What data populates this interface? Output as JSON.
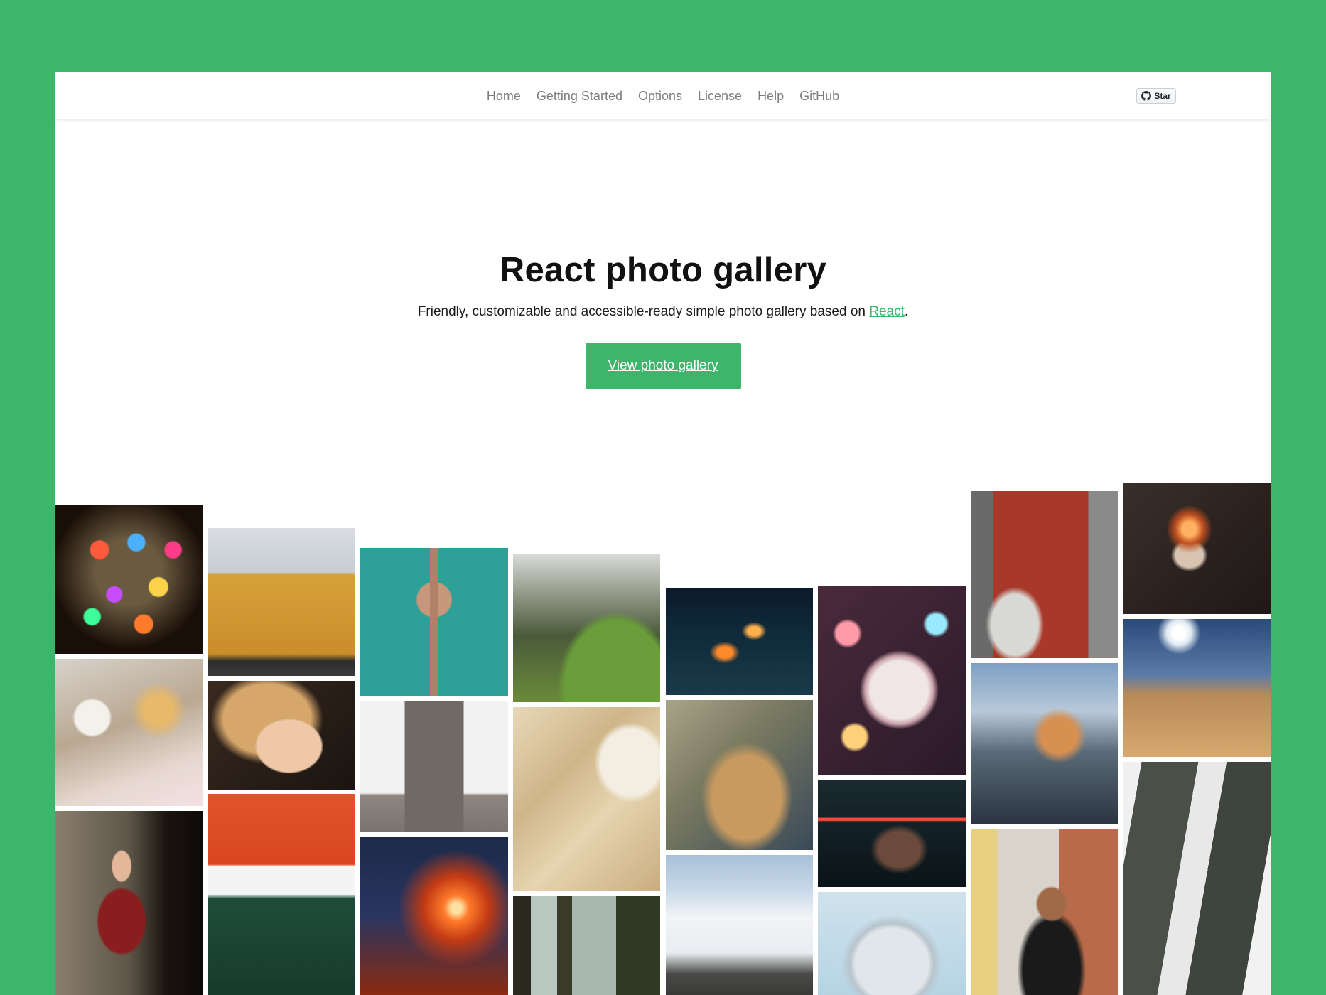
{
  "nav": {
    "items": [
      "Home",
      "Getting Started",
      "Options",
      "License",
      "Help",
      "GitHub"
    ],
    "star_label": "Star"
  },
  "hero": {
    "title": "React photo gallery",
    "subtitle_prefix": "Friendly, customizable and accessible-ready simple photo gallery based on ",
    "subtitle_link": "React",
    "subtitle_suffix": ".",
    "button_label": "View photo gallery"
  },
  "colors": {
    "brand": "#3db56b",
    "nav_text": "#7d7d7d"
  },
  "gallery": {
    "photos": [
      {
        "name": "bokeh-christmas-tree-photo"
      },
      {
        "name": "yellow-building-photo"
      },
      {
        "name": "aerial-pier-photo"
      },
      {
        "name": "machu-picchu-photo"
      },
      {
        "name": "city-night-aerial-photo"
      },
      {
        "name": "christmas-ornament-photo"
      },
      {
        "name": "brick-house-car-photo"
      },
      {
        "name": "campfire-photo"
      },
      {
        "name": "cozy-tea-book-photo"
      },
      {
        "name": "freckled-woman-portrait-photo"
      },
      {
        "name": "palace-of-culture-photo"
      },
      {
        "name": "sand-waves-aerial-photo"
      },
      {
        "name": "woman-hair-sunglasses-photo"
      },
      {
        "name": "motorcycle-night-photo"
      },
      {
        "name": "half-dome-photo"
      },
      {
        "name": "desert-sun-photo"
      },
      {
        "name": "woman-hat-portrait-photo"
      },
      {
        "name": "red-roof-house-photo"
      },
      {
        "name": "steel-wool-fire-photo"
      },
      {
        "name": "forest-trees-photo"
      },
      {
        "name": "snowy-mountains-photo"
      },
      {
        "name": "walkie-talkie-building-photo"
      },
      {
        "name": "man-street-portrait-photo"
      },
      {
        "name": "snowy-pines-photo"
      }
    ]
  }
}
